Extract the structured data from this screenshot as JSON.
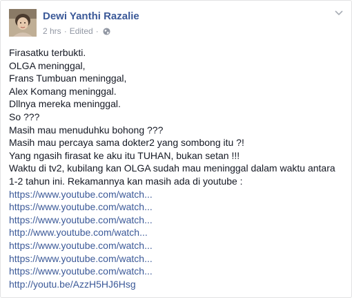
{
  "post": {
    "author": "Dewi Yanthi Razalie",
    "time": "2 hrs",
    "separator": "·",
    "edited": "Edited",
    "privacy_icon": "globe-icon",
    "menu_icon": "chevron-down-icon",
    "lines": [
      "Firasatku terbukti.",
      "OLGA meninggal,",
      "Frans Tumbuan meninggal,",
      "Alex Komang meninggal.",
      "Dllnya mereka meninggal.",
      "So ???",
      "Masih mau menuduhku bohong ???",
      "Masih mau percaya sama dokter2 yang sombong itu ?!",
      "Yang ngasih firasat ke aku itu TUHAN, bukan setan !!!",
      "Waktu di tv2, kubilang kan OLGA sudah mau meninggal dalam waktu antara 1-2 tahun ini. Rekamannya kan masih ada di youtube :"
    ],
    "links": [
      "https://www.youtube.com/watch...",
      "https://www.youtube.com/watch...",
      "https://www.youtube.com/watch...",
      "http://www.youtube.com/watch...",
      "https://www.youtube.com/watch...",
      "https://www.youtube.com/watch...",
      "https://www.youtube.com/watch...",
      "http://youtu.be/AzzH5HJ6Hsg"
    ]
  },
  "colors": {
    "link": "#3b5998",
    "meta": "#9197a3",
    "text": "#141823"
  }
}
